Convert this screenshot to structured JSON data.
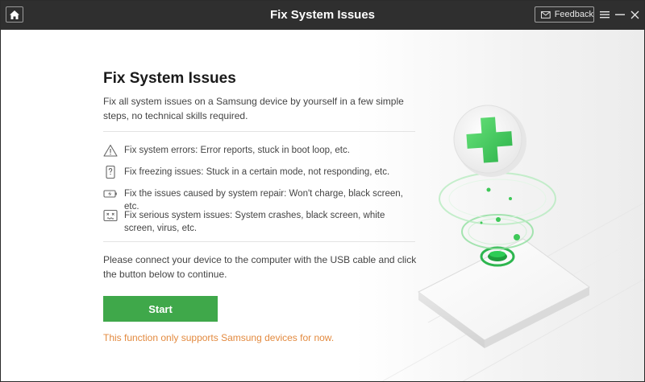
{
  "window": {
    "title": "Fix System Issues",
    "feedback_label": "Feedback"
  },
  "icons": {
    "home": "home-icon",
    "mail": "mail-icon",
    "menu": "menu-icon",
    "minimize": "minimize-icon",
    "close": "close-icon"
  },
  "main": {
    "heading": "Fix System Issues",
    "intro": "Fix all system issues on a Samsung device by yourself in a few simple steps, no technical skills required.",
    "features": [
      {
        "icon": "warning-icon",
        "text": "Fix system errors: Error reports, stuck in boot loop, etc."
      },
      {
        "icon": "phone-question-icon",
        "text": "Fix freezing issues: Stuck in a certain mode, not responding, etc."
      },
      {
        "icon": "battery-charge-icon",
        "text": "Fix the issues caused by system repair: Won't charge, black screen, etc."
      },
      {
        "icon": "crash-screen-icon",
        "text": "Fix serious system issues: System crashes, black screen, white screen, virus, etc."
      }
    ],
    "connect_text": "Please connect your device to the computer with the USB cable and click the button below to continue.",
    "start_label": "Start",
    "note": "This function only supports Samsung devices for now."
  },
  "colors": {
    "titlebar": "#2f2f2f",
    "accent_green": "#3fa84a",
    "note_orange": "#e38a3f"
  }
}
